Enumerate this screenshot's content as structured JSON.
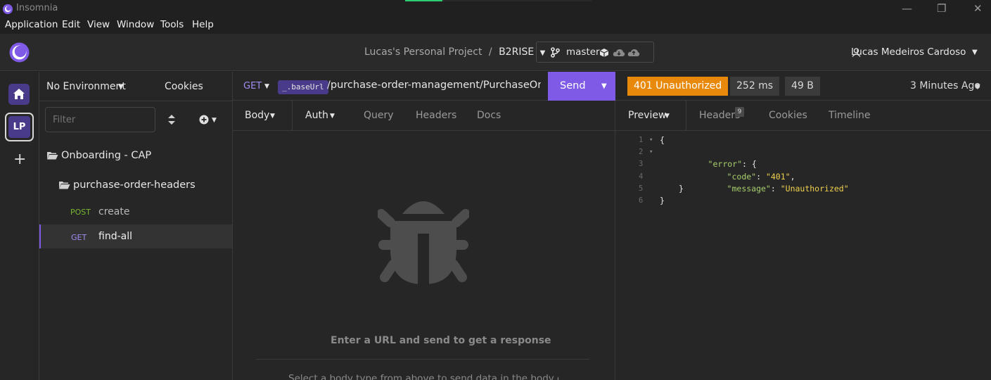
{
  "window": {
    "title": "Insomnia",
    "minimize": "—",
    "restore": "❐",
    "close": "✕"
  },
  "menu": [
    "Application",
    "Edit",
    "View",
    "Window",
    "Tools",
    "Help"
  ],
  "header": {
    "project": "Lucas's Personal Project",
    "separator": "/",
    "workspace": "B2RISE",
    "branch": "master",
    "user": "Lucas Medeiros Cardoso"
  },
  "rail": {
    "project_initials": "LP",
    "add": "+"
  },
  "sidebar": {
    "environment": "No Environment",
    "cookies": "Cookies",
    "filter_placeholder": "Filter",
    "folders": [
      {
        "name": "Onboarding - CAP"
      },
      {
        "name": "purchase-order-headers"
      }
    ],
    "requests": [
      {
        "method": "POST",
        "name": "create",
        "active": false
      },
      {
        "method": "GET",
        "name": "find-all",
        "active": true
      }
    ]
  },
  "request": {
    "method": "GET",
    "base_url_tag": "_.baseUrl",
    "url": "/purchase-order-management/PurchaseOrderHeaders",
    "send_label": "Send",
    "tabs": [
      "Body",
      "Auth",
      "Query",
      "Headers",
      "Docs"
    ],
    "empty_title": "Enter a URL and send to get a response",
    "empty_hint": "Select a body type from above to send data in the body of a request"
  },
  "response": {
    "status": "401 Unauthorized",
    "time": "252 ms",
    "size": "49 B",
    "age": "3 Minutes Ago",
    "tabs": [
      "Preview",
      "Headers",
      "Cookies",
      "Timeline"
    ],
    "headers_count": "9",
    "lines": [
      {
        "n": "1",
        "fold": "▾",
        "text": "{"
      },
      {
        "n": "2",
        "fold": "▾",
        "key": "\"error\"",
        "rest": ": {"
      },
      {
        "n": "3",
        "fold": "",
        "key": "\"code\"",
        "colon": ": ",
        "val": "\"401\"",
        "tail": ","
      },
      {
        "n": "4",
        "fold": "",
        "key": "\"message\"",
        "colon": ": ",
        "val": "\"Unauthorized\"",
        "tail": ""
      },
      {
        "n": "5",
        "fold": "",
        "text": "}"
      },
      {
        "n": "6",
        "fold": "",
        "text": "}"
      }
    ]
  },
  "colors": {
    "accent": "#7e5ae6",
    "status_401": "#e8890c",
    "json_key": "#a8cf6e",
    "json_string": "#f0d24d"
  }
}
